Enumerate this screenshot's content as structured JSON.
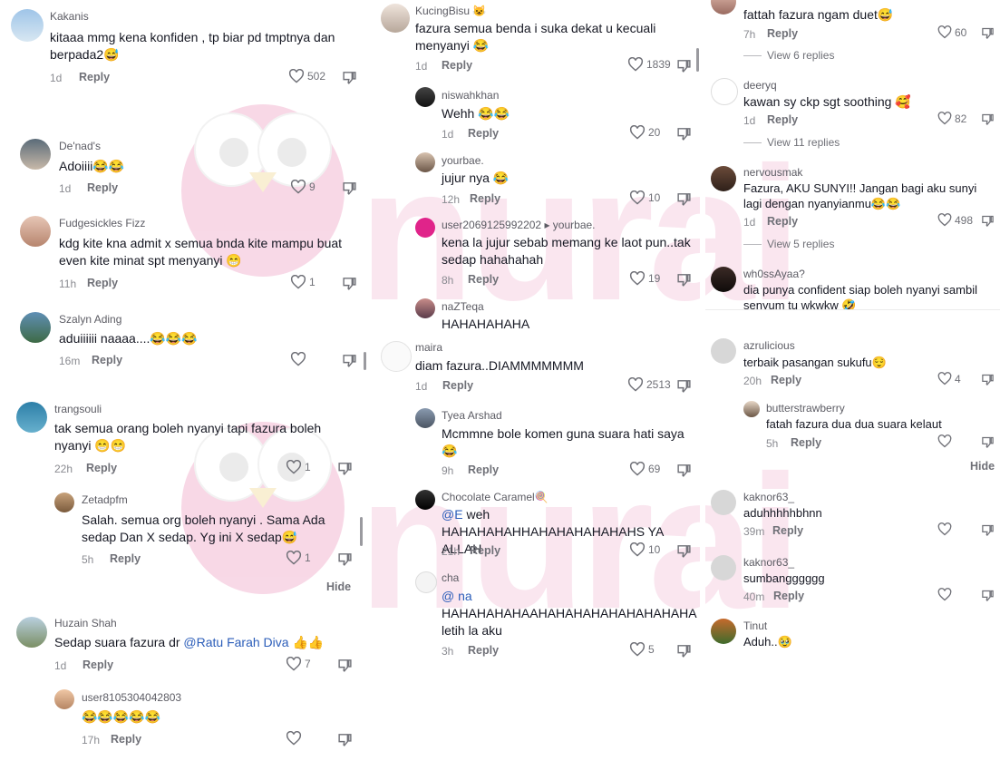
{
  "watermark": {
    "text": "nurai"
  },
  "reply_label": "Reply",
  "hide_label": "Hide",
  "col1": [
    {
      "user": "Kakanis",
      "text": "kitaaa mmg kena konfiden , tp biar pd tmptnya dan berpada2😅",
      "time": "1d",
      "likes": "502"
    },
    {
      "user": "De'nad's",
      "text": "Adoiiii😂😂",
      "time": "1d",
      "likes": "9"
    },
    {
      "user": "Fudgesickles Fizz",
      "text": "kdg kite kna admit x semua bnda kite mampu buat even kite minat spt menyanyi 😁",
      "time": "11h",
      "likes": "1"
    },
    {
      "user": "Szalyn Ading",
      "text": "aduiiiiii naaaa....😂😂😂",
      "time": "16m",
      "likes": ""
    },
    {
      "user": "trangsouli",
      "text": "tak semua orang boleh nyanyi tapi fazura boleh nyanyi 😁😁",
      "time": "22h",
      "likes": "1"
    },
    {
      "user": "Zetadpfm",
      "text": "Salah. semua org boleh nyanyi . Sama Ada sedap Dan X sedap. Yg ini X sedap😅",
      "time": "5h",
      "likes": "1"
    },
    {
      "user": "Huzain Shah",
      "text": "Sedap suara fazura dr ",
      "mention": "@Ratu Farah Diva",
      "text2": " 👍👍",
      "time": "1d",
      "likes": "7"
    },
    {
      "user": "user8105304042803",
      "text": "😂😂😂😂😂",
      "time": "17h",
      "likes": ""
    }
  ],
  "col2": [
    {
      "user": "KucingBisu 😺",
      "text": "fazura semua benda i suka dekat u kecuali menyanyi 😂",
      "time": "1d",
      "likes": "1839"
    },
    {
      "user": "niswahkhan",
      "text": "Wehh 😂😂",
      "time": "1d",
      "likes": "20"
    },
    {
      "user": "yourbae.",
      "text": "jujur nya 😂",
      "time": "12h",
      "likes": "10"
    },
    {
      "user": "user2069125992202",
      "reply_to": "▸ yourbae.",
      "text": "kena la jujur sebab memang ke laot pun..tak sedap hahahahah",
      "time": "8h",
      "likes": "19"
    },
    {
      "user": "naZTeqa",
      "text": "HAHAHAHAHA",
      "time": "",
      "likes": ""
    },
    {
      "user": "maira",
      "text": "diam fazura..DIAMMMMMMM",
      "time": "1d",
      "likes": "2513"
    },
    {
      "user": "Tyea Arshad",
      "text": "Mcmmne bole komen guna suara hati saya 😂",
      "time": "9h",
      "likes": "69"
    },
    {
      "user": "Chocolate Caramel🍭",
      "mention": "@E",
      "text": " weh HAHAHAHAHHAHAHAHAHAHAHS YA ALLAH",
      "time": "21h",
      "likes": "10"
    },
    {
      "user": "cha",
      "mention": "@  na",
      "text": "HAHAHAHAHAAHAHAHAHAHAHAHAHAHA letih la aku",
      "time": "3h",
      "likes": "5"
    }
  ],
  "col3": [
    {
      "user": "",
      "text": "fattah fazura ngam duet😅",
      "time": "7h",
      "likes": "60",
      "view": "View 6 replies"
    },
    {
      "user": "deeryq",
      "text": "kawan sy ckp sgt soothing 🥰",
      "time": "1d",
      "likes": "82",
      "view": "View 11 replies"
    },
    {
      "user": "nervousmak",
      "text": "Fazura, AKU SUNYI!! Jangan bagi aku sunyi lagi dengan nyanyianmu😂😂",
      "time": "1d",
      "likes": "498",
      "view": "View 5 replies"
    },
    {
      "user": "wh0ssAyaa?",
      "text": "dia punya confident siap boleh nyanyi sambil senyum tu wkwkw 🤣",
      "time": "",
      "likes": ""
    },
    {
      "user": "azrulicious",
      "text": "terbaik pasangan sukufu😌",
      "time": "20h",
      "likes": "4"
    },
    {
      "user": "butterstrawberry",
      "text": "fatah fazura dua dua suara kelaut",
      "time": "5h",
      "likes": ""
    },
    {
      "user": "kaknor63_",
      "text": "aduhhhhhbhnn",
      "time": "39m",
      "likes": ""
    },
    {
      "user": "kaknor63_",
      "text": "sumbangggggg",
      "time": "40m",
      "likes": ""
    },
    {
      "user": "Tinut",
      "text": "Aduh..🥹",
      "time": "",
      "likes": ""
    }
  ]
}
